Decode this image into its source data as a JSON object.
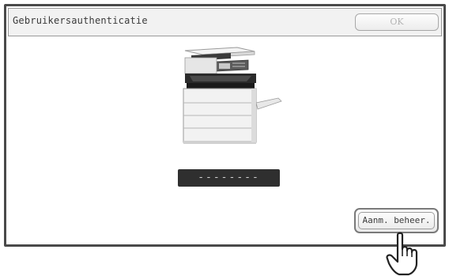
{
  "dialog": {
    "title": "Gebruikersauthenticatie",
    "ok_label": "OK"
  },
  "printer": {
    "icon": "printer-illustration-icon"
  },
  "password_field": {
    "masked_value": "--------"
  },
  "admin_button": {
    "label": "Aanm. beheer."
  },
  "pointer": {
    "icon": "pointing-hand-icon"
  }
}
